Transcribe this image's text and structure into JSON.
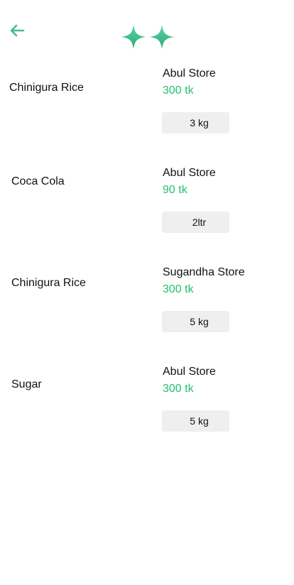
{
  "header": {
    "back_icon": "arrow-left-icon",
    "logo_icon": "sparkle-pair-icon",
    "accent": "#3fbf8f"
  },
  "items": [
    {
      "name": "Chinigura Rice",
      "store": "Abul Store",
      "price": "300 tk",
      "quantity": "3 kg"
    },
    {
      "name": "Coca Cola",
      "store": "Abul Store",
      "price": "90 tk",
      "quantity": "2ltr"
    },
    {
      "name": "Chinigura Rice",
      "store": "Sugandha Store",
      "price": "300 tk",
      "quantity": "5 kg"
    },
    {
      "name": "Sugar",
      "store": "Abul Store",
      "price": "300 tk",
      "quantity": "5 kg"
    }
  ],
  "colors": {
    "price": "#22c06d",
    "quantity_bg": "#efefef"
  }
}
